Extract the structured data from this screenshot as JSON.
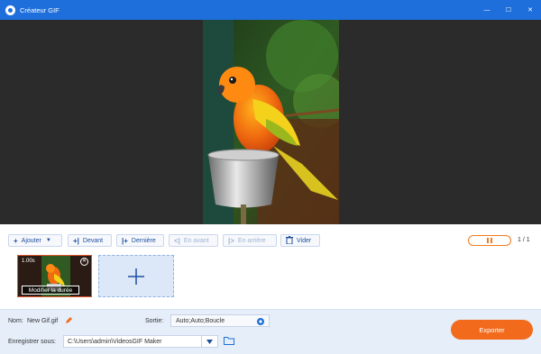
{
  "window": {
    "title": "Créateur GIF",
    "controls": {
      "minimize": "—",
      "maximize": "☐",
      "close": "✕"
    }
  },
  "toolbar": {
    "add": {
      "icon": "+",
      "label": "Ajouter"
    },
    "front": {
      "icon": "+|",
      "label": "Devant"
    },
    "behind": {
      "icon": "|+",
      "label": "Dernière"
    },
    "forward": {
      "icon": "<|",
      "label": "En avant"
    },
    "backward": {
      "icon": "|>",
      "label": "En arrière"
    },
    "clear": {
      "label": "Vider"
    },
    "page": "1 / 1"
  },
  "frames": [
    {
      "duration": "1.00s",
      "edit_label": "Modifier la durée"
    }
  ],
  "settings": {
    "name_label": "Nom:",
    "name_value": "New Gif.gif",
    "output_label": "Sortie:",
    "output_value": "Auto;Auto;Boucle",
    "save_label": "Enregistrer sous:",
    "save_path": "C:\\Users\\admin\\VideosGIF Maker"
  },
  "export_label": "Exporter",
  "colors": {
    "accent": "#1e6fdc",
    "export": "#f26b1d"
  },
  "icons": [
    "app-logo-icon",
    "plus-icon",
    "trash-icon",
    "pause-icon",
    "close-icon",
    "pencil-icon",
    "gear-icon",
    "folder-icon",
    "chevron-down-icon"
  ]
}
